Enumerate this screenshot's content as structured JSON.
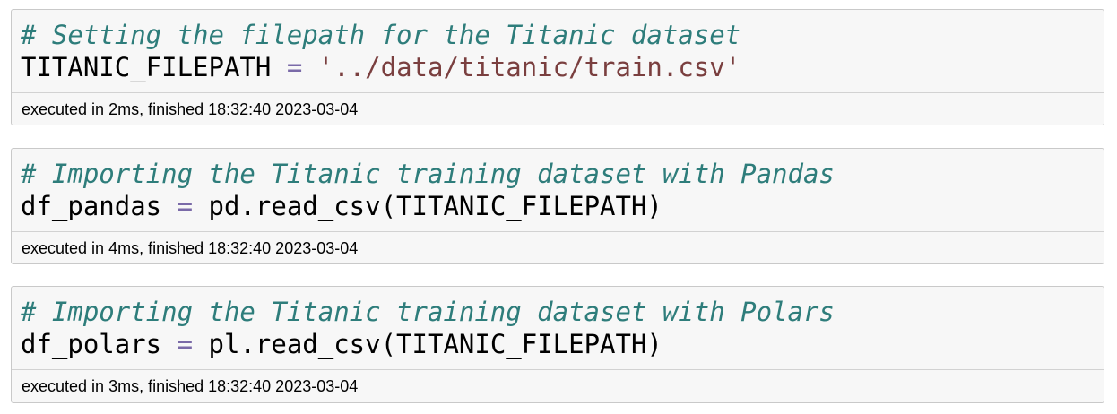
{
  "cells": [
    {
      "comment": "# Setting the filepath for the Titanic dataset",
      "lhs": "TITANIC_FILEPATH",
      "op": "=",
      "rhs": "'../data/titanic/train.csv'",
      "execution_info": "executed in 2ms, finished 18:32:40 2023-03-04"
    },
    {
      "comment": "# Importing the Titanic training dataset with Pandas",
      "lhs": "df_pandas",
      "op": "=",
      "rhs": "pd.read_csv(TITANIC_FILEPATH)",
      "execution_info": "executed in 4ms, finished 18:32:40 2023-03-04"
    },
    {
      "comment": "# Importing the Titanic training dataset with Polars",
      "lhs": "df_polars",
      "op": "=",
      "rhs": "pl.read_csv(TITANIC_FILEPATH)",
      "execution_info": "executed in 3ms, finished 18:32:40 2023-03-04"
    }
  ],
  "colors": {
    "comment": "#2e7d7b",
    "operator": "#7a6aa8",
    "string": "#7a3f3f",
    "cell_background": "#f7f7f7",
    "cell_border": "#c9c9c9"
  }
}
